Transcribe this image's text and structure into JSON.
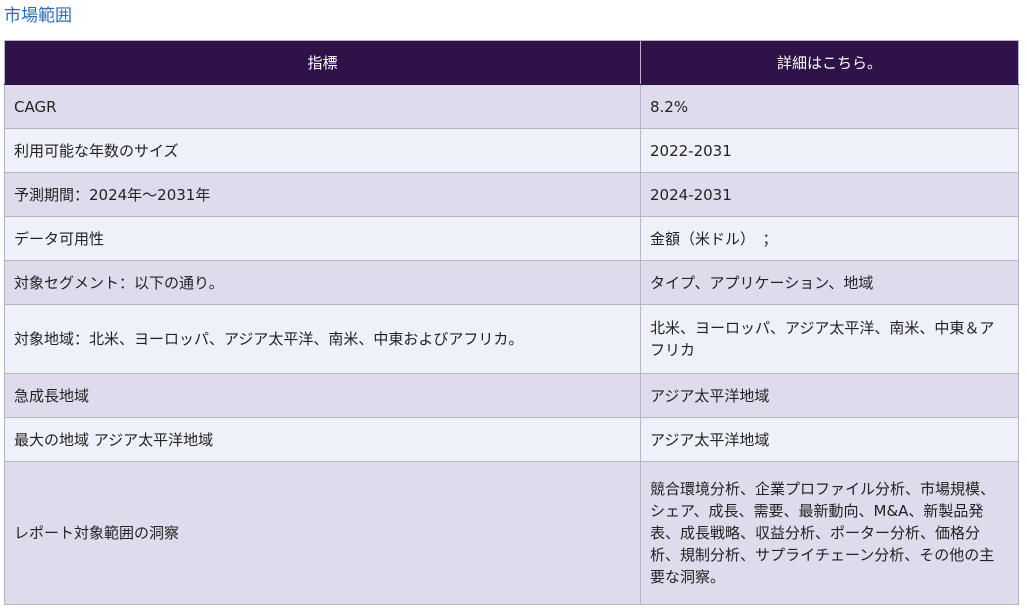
{
  "heading": "市場範囲",
  "table": {
    "headers": [
      "指標",
      "詳細はこちら。"
    ],
    "rows": [
      {
        "label": "CAGR",
        "value": "8.2%"
      },
      {
        "label": "利用可能な年数のサイズ",
        "value": "2022-2031"
      },
      {
        "label": "予測期間：2024年～2031年",
        "value": "2024-2031"
      },
      {
        "label": "データ可用性",
        "value": "金額（米ドル）　；"
      },
      {
        "label": "対象セグメント：以下の通り。",
        "value": "タイプ、アプリケーション、地域"
      },
      {
        "label": "対象地域：北米、ヨーロッパ、アジア太平洋、南米、中東およびアフリカ。",
        "value": "北米、ヨーロッパ、アジア太平洋、南米、中東＆アフリカ"
      },
      {
        "label": "急成長地域",
        "value": "アジア太平洋地域"
      },
      {
        "label": "最大の地域 アジア太平洋地域",
        "value": "アジア太平洋地域"
      },
      {
        "label": "レポート対象範囲の洞察",
        "value": "競合環境分析、企業プロファイル分析、市場規模、シェア、成長、需要、最新動向、M&A、新製品発表、成長戦略、収益分析、ポーター分析、価格分析、規制分析、サプライチェーン分析、その他の主要な洞察。"
      }
    ]
  }
}
